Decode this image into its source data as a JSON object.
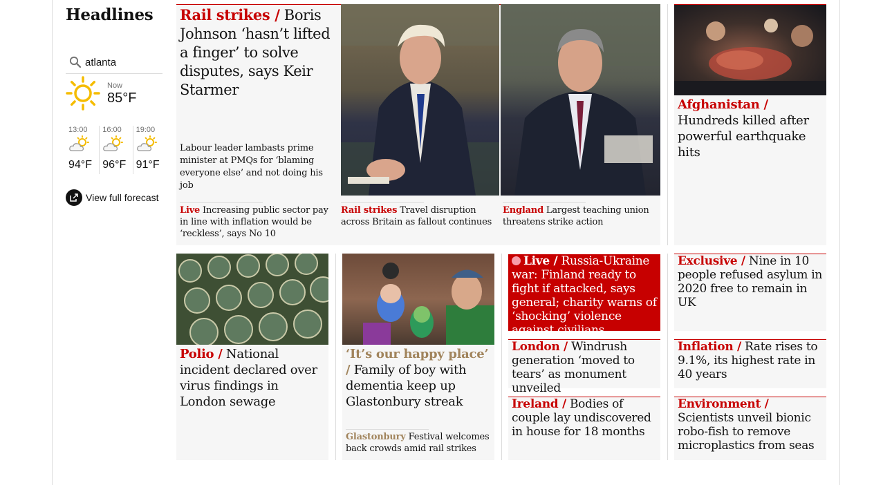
{
  "section_title": "Headlines",
  "weather": {
    "search_value": "atlanta",
    "now_label": "Now",
    "now_temp": "85°F",
    "forecast": [
      {
        "time": "13:00",
        "temp": "94°F",
        "icon": "partly-cloudy-icon"
      },
      {
        "time": "16:00",
        "temp": "96°F",
        "icon": "partly-cloudy-icon"
      },
      {
        "time": "19:00",
        "temp": "91°F",
        "icon": "partly-cloudy-icon"
      }
    ],
    "full_forecast_label": "View full forecast"
  },
  "colors": {
    "news_red": "#c70000",
    "culture_gold": "#a1845c",
    "card_bg": "#f6f6f6",
    "rule": "#dcdcdc"
  },
  "lead": {
    "kicker": "Rail strikes /",
    "headline": "Boris Johnson ‘hasn’t lifted a finger’ to solve disputes, says Keir Starmer",
    "standfirst": "Labour leader lambasts prime minister at PMQs for ‘blaming everyone else’ and not doing his job",
    "sublinks": [
      {
        "kicker": "Live",
        "text": "Increasing public sector pay in line with inflation would be ‘reckless’, says No 10"
      },
      {
        "kicker": "Rail strikes",
        "text": "Travel disruption across Britain as fallout continues"
      },
      {
        "kicker": "England",
        "text": "Largest teaching union threatens strike action"
      }
    ]
  },
  "afghanistan": {
    "kicker": "Afghanistan /",
    "headline": "Hundreds killed after powerful earthquake hits"
  },
  "polio": {
    "kicker": "Polio /",
    "headline": "National incident declared over virus findings in London sewage"
  },
  "glastonbury": {
    "kicker": "‘It’s our happy place’ /",
    "headline": "Family of boy with dementia keep up Glastonbury streak",
    "sub_kicker": "Glastonbury",
    "sub_text": "Festival welcomes back crowds amid rail strikes"
  },
  "ukraine": {
    "kicker": "Live /",
    "headline": "Russia-Ukraine war: Finland ready to fight if attacked, says general; charity warns of ‘shocking’ violence against civilians"
  },
  "windrush": {
    "kicker": "London /",
    "headline": "Windrush generation ‘moved to tears’ as monument unveiled"
  },
  "ireland": {
    "kicker": "Ireland /",
    "headline": "Bodies of couple lay undiscovered in house for 18 months"
  },
  "asylum": {
    "kicker": "Exclusive /",
    "headline": "Nine in 10 people refused asylum in 2020 free to remain in UK"
  },
  "inflation": {
    "kicker": "Inflation /",
    "headline": "Rate rises to 9.1%, its highest rate in 40 years"
  },
  "environment": {
    "kicker": "Environment /",
    "headline": "Scientists unveil bionic robo-fish to remove microplastics from seas"
  }
}
